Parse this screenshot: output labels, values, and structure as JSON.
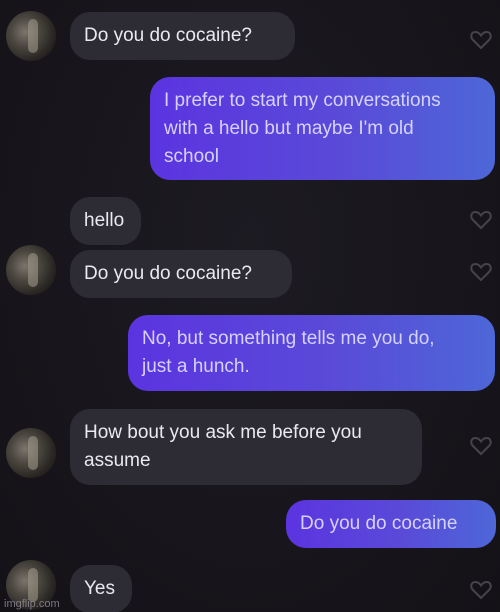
{
  "conversation": {
    "messages": [
      {
        "side": "in",
        "text": "Do you do cocaine?"
      },
      {
        "side": "out",
        "text": "I prefer to start my conversations\nwith a hello but maybe I'm old\nschool"
      },
      {
        "side": "in",
        "text": "hello"
      },
      {
        "side": "in",
        "text": "Do you do cocaine?"
      },
      {
        "side": "out",
        "text": "No, but something tells me you do,\njust a hunch."
      },
      {
        "side": "in",
        "text": "How bout you ask me before you\nassume"
      },
      {
        "side": "out",
        "text": "Do you do cocaine"
      },
      {
        "side": "in",
        "text": "Yes"
      }
    ]
  },
  "colors": {
    "incoming_bubble": "#2d2b34",
    "outgoing_gradient_start": "#5b34e0",
    "outgoing_gradient_end": "#4d67d8",
    "background": "#17151b"
  },
  "icons": {
    "like": "heart-outline-icon"
  },
  "watermark": "imgflip.com"
}
